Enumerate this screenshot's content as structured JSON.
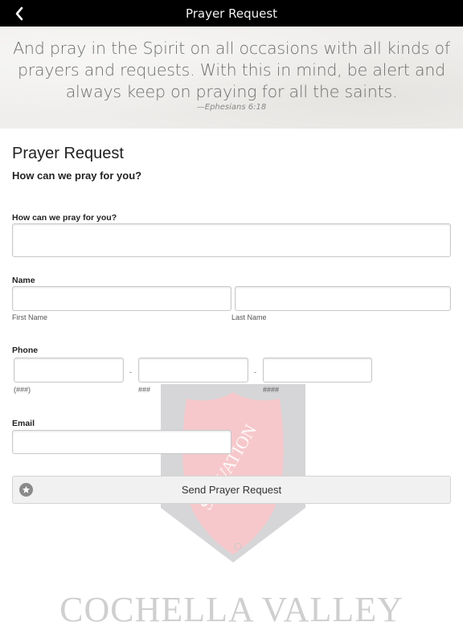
{
  "navbar": {
    "title": "Prayer Request",
    "back_icon": "chevron-left-icon"
  },
  "banner": {
    "verse": "And pray in the Spirit on all occasions with all kinds of prayers and requests. With this in mind, be alert and always keep on praying for all the saints.",
    "reference": "—Ephesians 6:18"
  },
  "form": {
    "title": "Prayer Request",
    "subtitle": "How can we pray for you?",
    "prayer": {
      "label": "How can we pray for you?",
      "value": ""
    },
    "name": {
      "label": "Name",
      "first": {
        "value": "",
        "sublabel": "First Name"
      },
      "last": {
        "value": "",
        "sublabel": "Last Name"
      }
    },
    "phone": {
      "label": "Phone",
      "separator": "-",
      "area": {
        "value": "",
        "sublabel": "(###)"
      },
      "prefix": {
        "value": "",
        "sublabel": "###"
      },
      "line": {
        "value": "",
        "sublabel": "####"
      }
    },
    "email": {
      "label": "Email",
      "value": ""
    },
    "submit": {
      "label": "Send Prayer Request",
      "icon": "star-icon"
    }
  },
  "watermark": {
    "logo": "salvation-army-shield",
    "shield_text": "THE SALVATION ARMY",
    "caption": "COCHELLA VALLEY",
    "colors": {
      "shield": "#f7c9cc",
      "backdrop": "#d6d6d8"
    }
  },
  "colors": {
    "navbar_bg": "#000000",
    "banner_bg": "#efeeec",
    "button_bg": "#f1f1f1"
  }
}
